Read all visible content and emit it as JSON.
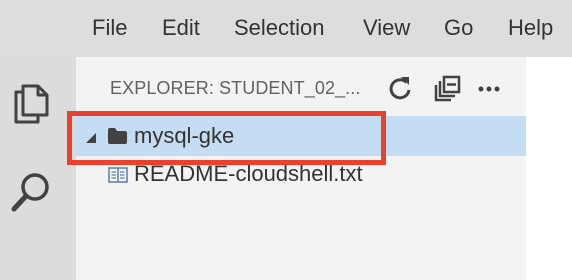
{
  "menu": {
    "items": [
      "File",
      "Edit",
      "Selection",
      "View",
      "Go",
      "Help"
    ]
  },
  "activity_bar": {
    "items": [
      {
        "icon": "explorer-files-icon"
      },
      {
        "icon": "search-icon"
      }
    ]
  },
  "explorer": {
    "title": "EXPLORER: STUDENT_02_...",
    "actions": [
      {
        "icon": "refresh-icon"
      },
      {
        "icon": "collapse-all-icon"
      },
      {
        "icon": "more-actions-icon"
      }
    ],
    "tree": [
      {
        "label": "mysql-gke",
        "type": "folder",
        "expanded": true,
        "selected": true,
        "icon": "folder-icon"
      },
      {
        "label": "README-cloudshell.txt",
        "type": "file",
        "icon": "text-file-icon"
      }
    ]
  },
  "colors": {
    "menubar_bg": "#dddddd",
    "activitybar_bg": "#dcdcdc",
    "sidebar_bg": "#f3f3f3",
    "selection_bg": "#c5ddf3",
    "highlight_border": "#e8412e",
    "icon_color": "#424242"
  }
}
